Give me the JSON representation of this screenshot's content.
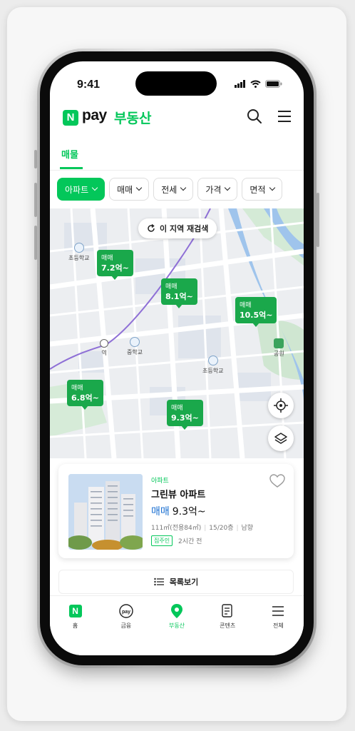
{
  "status": {
    "time": "9:41"
  },
  "brand": {
    "n": "N",
    "pay": "pay",
    "service": "부동산",
    "accent": "#03c75a"
  },
  "tabs": [
    {
      "label": "매물",
      "active": true
    }
  ],
  "filters": [
    {
      "label": "아파트",
      "active": true
    },
    {
      "label": "매매",
      "active": false
    },
    {
      "label": "전세",
      "active": false
    },
    {
      "label": "가격",
      "active": false
    },
    {
      "label": "면적",
      "active": false
    }
  ],
  "map": {
    "research_label": "이 지역 재검색",
    "pins": [
      {
        "deal": "매매",
        "price": "7.2억~"
      },
      {
        "deal": "매매",
        "price": "8.1억~"
      },
      {
        "deal": "매매",
        "price": "10.5억~"
      },
      {
        "deal": "매매",
        "price": "6.8억~"
      },
      {
        "deal": "매매",
        "price": "9.3억~"
      }
    ],
    "pois": {
      "elementary_1": "초등학교",
      "middle": "중학교",
      "elementary_2": "초등학교",
      "station": "역",
      "park": "공원"
    }
  },
  "listing": {
    "type": "아파트",
    "name": "그린뷰 아파트",
    "deal": "매매",
    "price": "9.3억~",
    "area": "111㎡(전용84㎡)",
    "floor": "15/20층",
    "direction": "남향",
    "badge": "집주인",
    "time": "2시간 전"
  },
  "list_button": "목록보기",
  "bottom_nav": [
    {
      "label": "홈",
      "icon": "naver-n-icon"
    },
    {
      "label": "금융",
      "icon": "pay-icon"
    },
    {
      "label": "부동산",
      "icon": "map-pin-icon",
      "active": true
    },
    {
      "label": "콘텐츠",
      "icon": "document-icon"
    },
    {
      "label": "전체",
      "icon": "menu-icon"
    }
  ]
}
